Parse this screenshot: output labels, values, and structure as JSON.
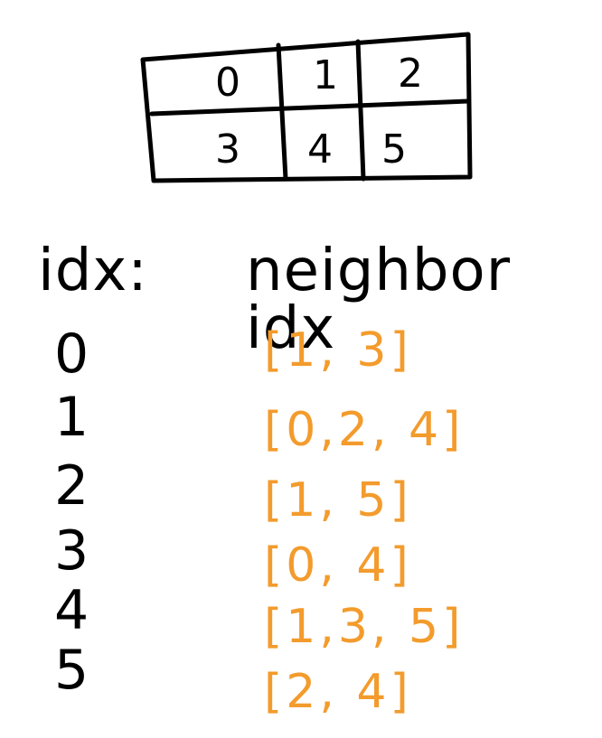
{
  "grid": {
    "cells": [
      "0",
      "1",
      "2",
      "3",
      "4",
      "5"
    ]
  },
  "headers": {
    "idx": "idx:",
    "neighbor_idx": "neighbor idx"
  },
  "rows": [
    {
      "idx": "0",
      "neighbors": "[1, 3]"
    },
    {
      "idx": "1",
      "neighbors": "[0,2, 4]"
    },
    {
      "idx": "2",
      "neighbors": "[1, 5]"
    },
    {
      "idx": "3",
      "neighbors": "[0, 4]"
    },
    {
      "idx": "4",
      "neighbors": "[1,3, 5]"
    },
    {
      "idx": "5",
      "neighbors": "[2, 4]"
    }
  ],
  "colors": {
    "ink": "#000000",
    "neighbor_ink": "#f39b2c",
    "background": "#ffffff"
  }
}
